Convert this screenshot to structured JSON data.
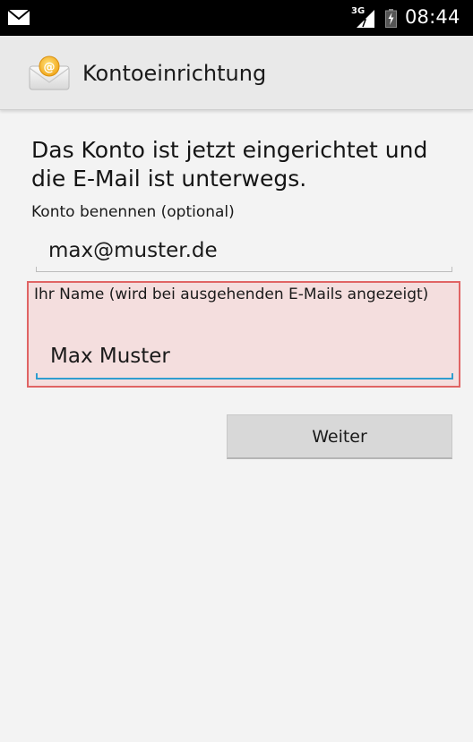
{
  "status_bar": {
    "notification_icon": "mail-icon",
    "network_type": "3G",
    "battery_icon": "battery-charging-icon",
    "time": "08:44"
  },
  "action_bar": {
    "app_icon": "email-envelope-icon",
    "title": "Kontoeinrichtung"
  },
  "content": {
    "headline": "Das Konto ist jetzt eingerichtet und die E-Mail ist unterwegs.",
    "account_name_label": "Konto benennen (optional)",
    "account_name_value": "max@muster.de",
    "your_name_label": "Ihr Name (wird bei ausgehenden E-Mails angezeigt)",
    "your_name_value": "Max Muster",
    "next_button": "Weiter"
  },
  "colors": {
    "focus_accent": "#2f9ed0",
    "highlight_border": "#e06464",
    "highlight_fill": "#f4dede"
  }
}
